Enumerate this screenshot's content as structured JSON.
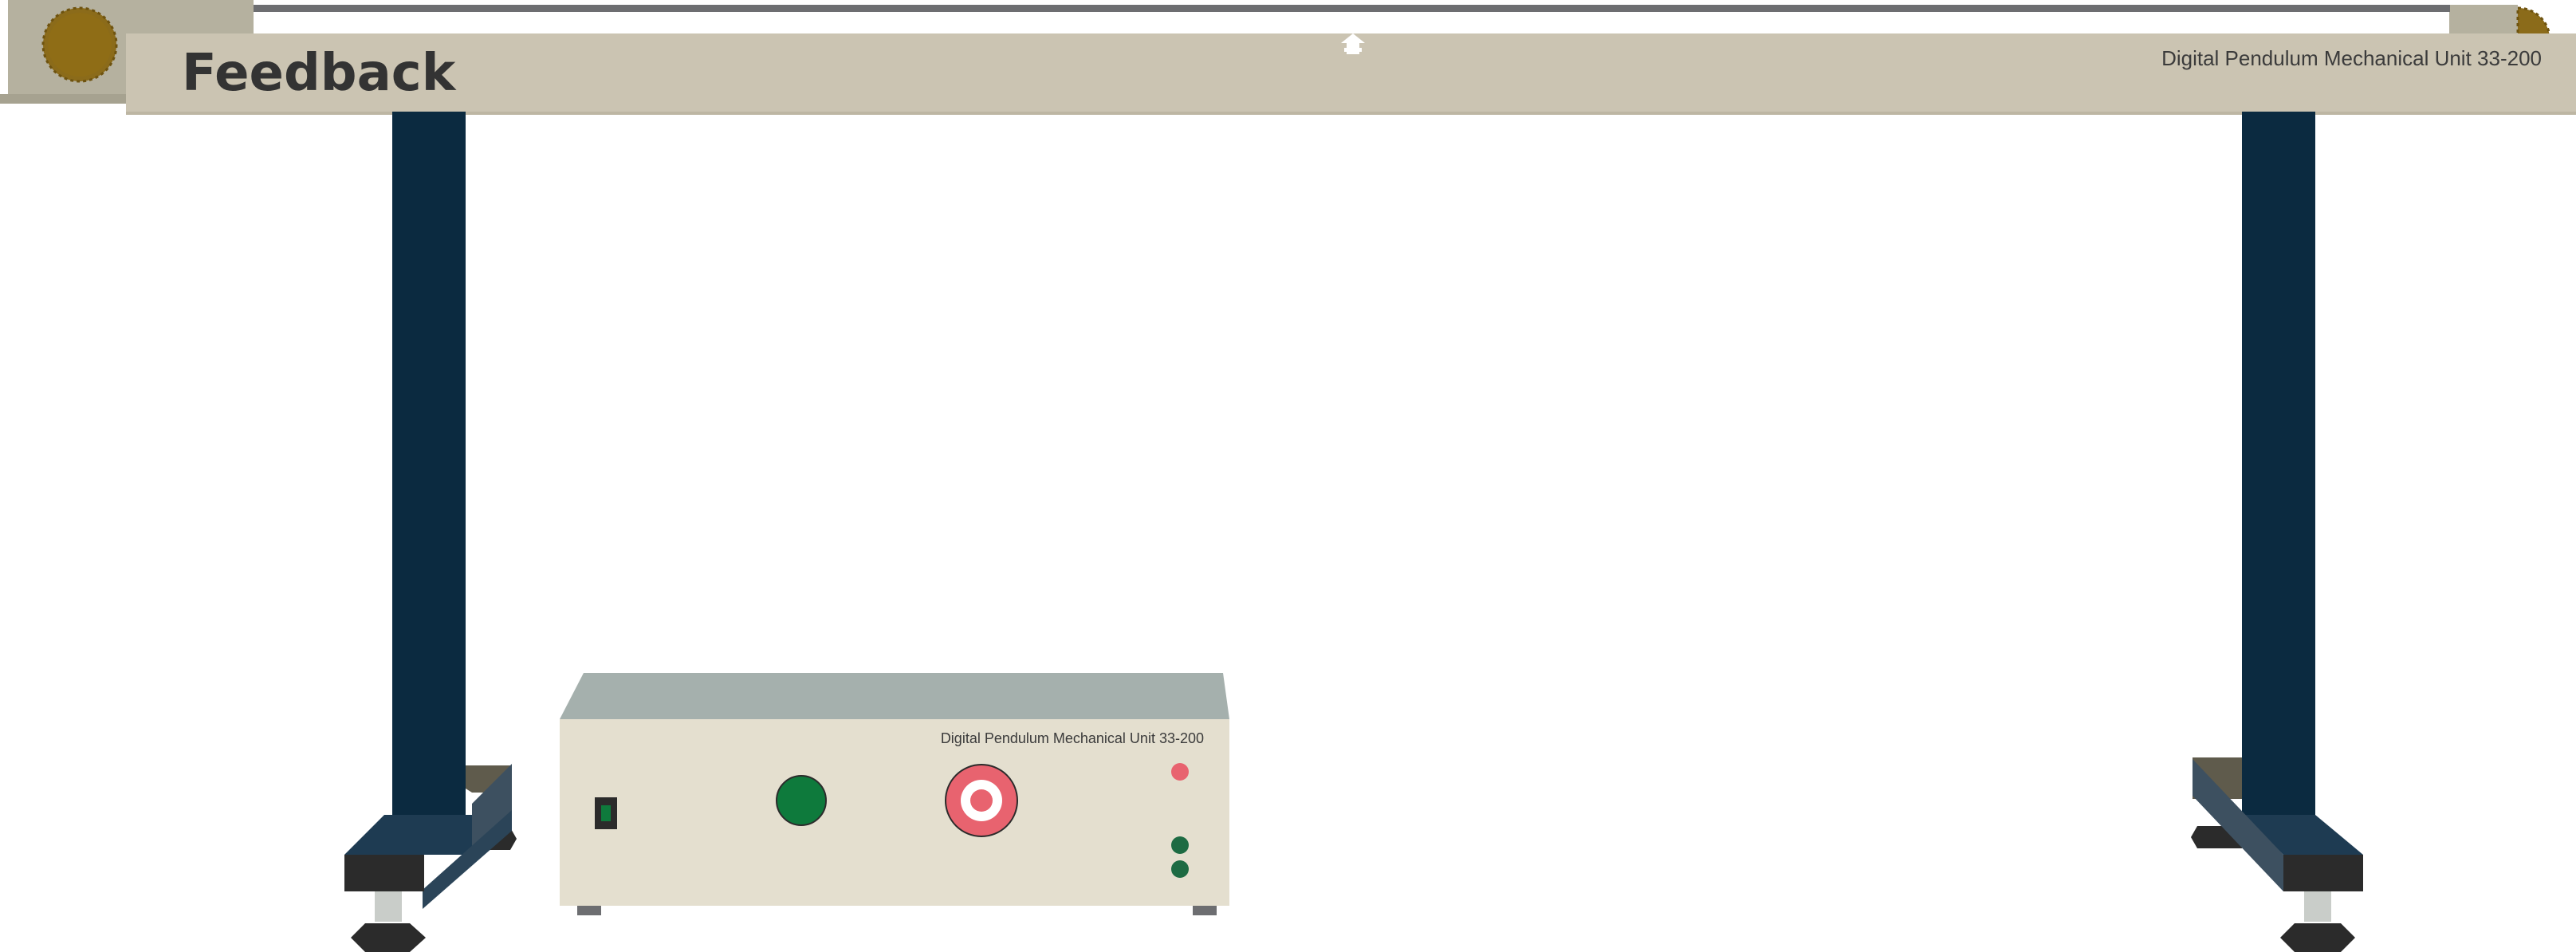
{
  "rail": {
    "brand": "Feedback",
    "model_label": "Digital Pendulum Mechanical Unit 33-200"
  },
  "control_box": {
    "label": "Digital Pendulum Mechanical Unit 33-200"
  },
  "colors": {
    "rail": "#cbc4b2",
    "wheel_housing": "#b5b19f",
    "wheel": "#8b6b1a",
    "rod": "#6d6e71",
    "leg": "#0b2a40",
    "base_dark": "#2b2b2b",
    "base_blue": "#1e3b52",
    "box_top": "#a5b0ad",
    "box_front": "#e4dfcf",
    "button_green": "#0e7a3c",
    "emergency_red": "#e8636f",
    "led_red": "#e8636f",
    "led_green": "#1d6b43",
    "switch": "#2b2b2b"
  }
}
